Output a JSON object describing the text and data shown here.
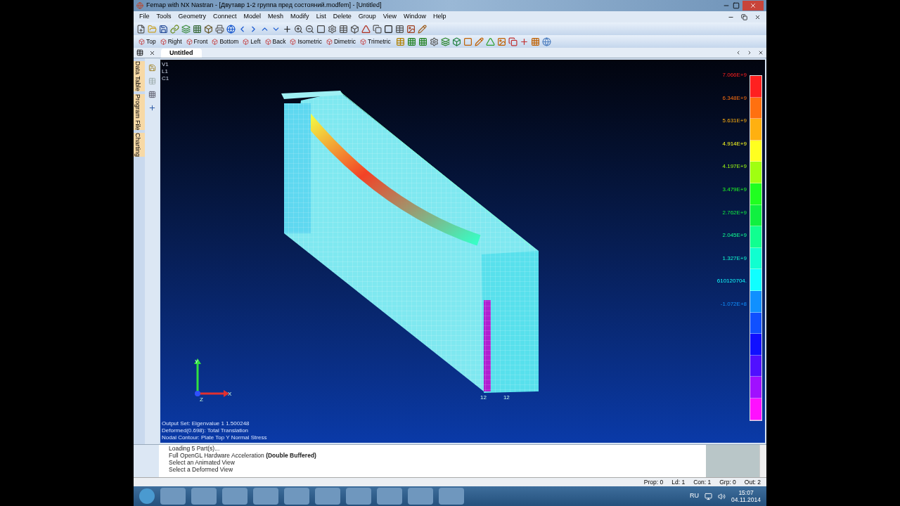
{
  "window": {
    "title": "Femap with NX Nastran - [Двутавр 1-2 группа пред состояний.modfem] - [Untitled]"
  },
  "menu": [
    "File",
    "Tools",
    "Geometry",
    "Connect",
    "Model",
    "Mesh",
    "Modify",
    "List",
    "Delete",
    "Group",
    "View",
    "Window",
    "Help"
  ],
  "view_buttons": [
    "Top",
    "Right",
    "Front",
    "Bottom",
    "Left",
    "Back",
    "Isometric",
    "Dimetric",
    "Trimetric"
  ],
  "tabs": [
    {
      "label": "Untitled",
      "selected": true
    }
  ],
  "side_tabs": [
    "Data Table",
    "Program File",
    "Charting"
  ],
  "viewport": {
    "corner_labels": [
      "V1",
      "L1",
      "C1"
    ],
    "info_lines": [
      "Output Set: Eigenvalue 1 1.500248",
      "Deformed(0.698): Total Translation",
      "Nodal Contour: Plate Top Y Normal Stress"
    ],
    "node_labels": [
      "12",
      "12"
    ],
    "axes": {
      "y": "Y",
      "x": "X",
      "z": "Z"
    },
    "legend": [
      "7.066E+9",
      "6.348E+9",
      "5.631E+9",
      "4.914E+9",
      "4.197E+9",
      "3.479E+9",
      "2.762E+9",
      "2.045E+9",
      "1.327E+9",
      "610120704.",
      "-1.072E+8"
    ]
  },
  "messages": [
    "Loading 5 Part(s)...",
    "Full OpenGL Hardware Acceleration **(Double Buffered)**",
    "Select an Animated View",
    "Select a Deformed View"
  ],
  "status_bar": [
    "Prop: 0",
    "Ld: 1",
    "Con: 1",
    "Grp: 0",
    "Out: 2"
  ],
  "taskbar": {
    "language": "RU",
    "time": "15:07",
    "date": "04.11.2014"
  }
}
